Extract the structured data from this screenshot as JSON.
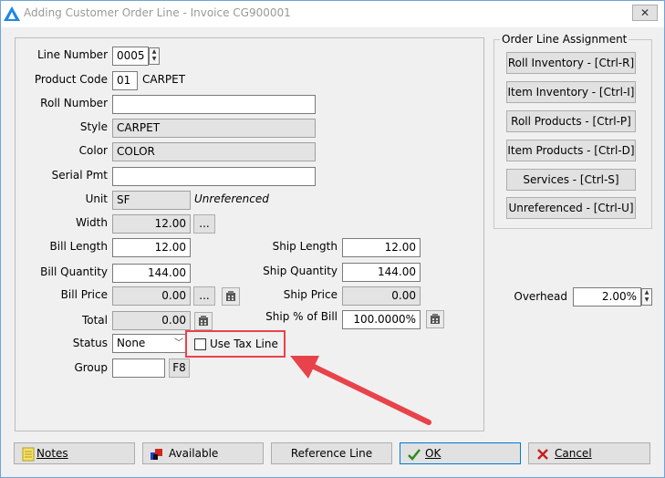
{
  "window": {
    "title": "Adding Customer Order Line - Invoice CG900001",
    "close_glyph": "✕"
  },
  "form": {
    "line_number": {
      "label": "Line Number",
      "value": "0005"
    },
    "product_code": {
      "label": "Product Code",
      "code": "01",
      "name": "CARPET"
    },
    "roll_number": {
      "label": "Roll Number",
      "value": ""
    },
    "style": {
      "label": "Style",
      "value": "CARPET"
    },
    "color": {
      "label": "Color",
      "value": "COLOR"
    },
    "serial_pmt": {
      "label": "Serial Pmt",
      "value": ""
    },
    "unit": {
      "label": "Unit",
      "value": "SF",
      "note": "Unreferenced"
    },
    "width": {
      "label": "Width",
      "value": "12.00",
      "button": "..."
    },
    "bill_length": {
      "label": "Bill Length",
      "value": "12.00"
    },
    "bill_quantity": {
      "label": "Bill Quantity",
      "value": "144.00"
    },
    "bill_price": {
      "label": "Bill Price",
      "value": "0.00",
      "button": "..."
    },
    "total": {
      "label": "Total",
      "value": "0.00"
    },
    "status": {
      "label": "Status",
      "value": "None"
    },
    "use_tax_line": {
      "label": "Use Tax Line",
      "checked": false
    },
    "group": {
      "label": "Group",
      "value": "",
      "button": "F8"
    },
    "ship_length": {
      "label": "Ship Length",
      "value": "12.00"
    },
    "ship_quantity": {
      "label": "Ship Quantity",
      "value": "144.00"
    },
    "ship_price": {
      "label": "Ship Price",
      "value": "0.00"
    },
    "ship_pct_of_bill": {
      "label": "Ship % of Bill",
      "value": "100.0000%"
    },
    "overhead": {
      "label": "Overhead",
      "value": "2.00%"
    }
  },
  "assignment": {
    "title": "Order Line Assignment",
    "buttons": [
      "Roll Inventory - [Ctrl-R]",
      "Item Inventory - [Ctrl-I]",
      "Roll Products - [Ctrl-P]",
      "Item Products - [Ctrl-D]",
      "Services - [Ctrl-S]",
      "Unreferenced - [Ctrl-U]"
    ]
  },
  "footer": {
    "notes": "Notes",
    "available": "Available",
    "reference_line": "Reference Line",
    "ok": "OK",
    "cancel": "Cancel"
  },
  "colors": {
    "annotation": "#e8434b",
    "accent": "#0078d7"
  }
}
